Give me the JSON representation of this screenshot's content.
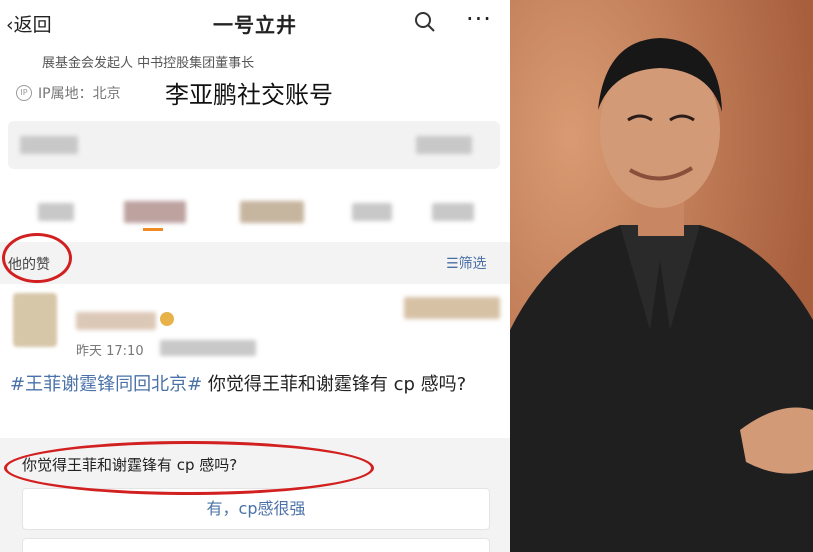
{
  "header": {
    "back_label": "返回",
    "title": "一号立井"
  },
  "profile": {
    "bio": "展基金会发起人 中书控股集团董事长",
    "ip_label": "IP属地：北京",
    "annotation": "李亚鹏社交账号"
  },
  "likes": {
    "tab_label": "他的赞",
    "filter_label": "筛选"
  },
  "post": {
    "time": "昨天 17:10",
    "hashtag": "#王菲谢霆锋同回北京#",
    "text": " 你觉得王菲和谢霆锋有 cp 感吗?",
    "poll_question": "你觉得王菲和谢霆锋有 cp 感吗?",
    "poll_option_1": "有，cp感很强"
  },
  "icons": [
    "chevron-left-icon",
    "search-icon",
    "more-icon",
    "ip-location-icon",
    "filter-icon"
  ],
  "colors": {
    "link_blue": "#4a72a8",
    "annotation_red": "#d21f1f",
    "panel_gray": "#f3f3f3"
  }
}
